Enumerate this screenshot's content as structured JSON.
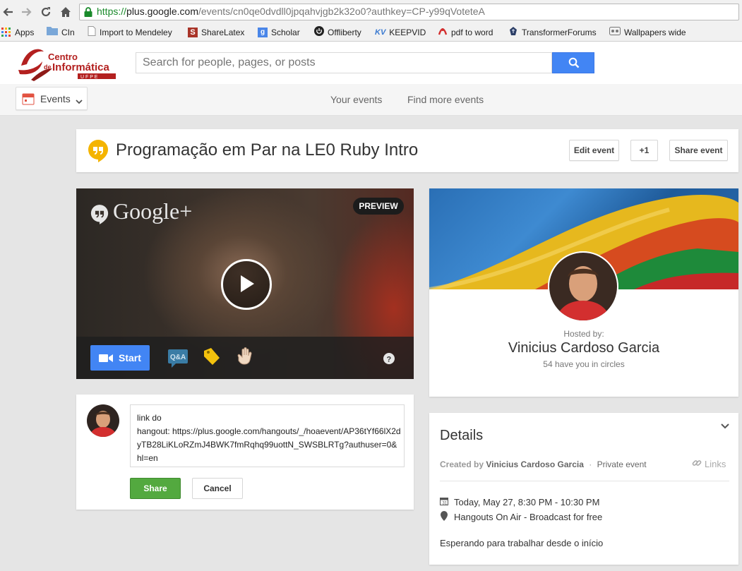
{
  "browser": {
    "url_https": "https://",
    "url_host": "plus.google.com",
    "url_path": "/events/cn0qe0dvdll0jpqahvjgb2k32o0?authkey=CP-y99qVoteteA",
    "bookmarks": [
      {
        "label": "Apps",
        "icon": "apps-grid-icon",
        "color": "#e94235"
      },
      {
        "label": "CIn",
        "icon": "folder-icon",
        "color": "#7aa7d8"
      },
      {
        "label": "Import to Mendeley",
        "icon": "page-icon",
        "color": "#ffffff"
      },
      {
        "label": "ShareLatex",
        "icon": "sharelatex-icon",
        "color": "#a93529"
      },
      {
        "label": "Scholar",
        "icon": "scholar-icon",
        "color": "#4a86e8"
      },
      {
        "label": "Offliberty",
        "icon": "power-icon",
        "color": "#222222"
      },
      {
        "label": "KEEPVID",
        "icon": "kv-icon",
        "color": "#3c7bd1",
        "badge": "KV"
      },
      {
        "label": "pdf to word",
        "icon": "pdf-icon",
        "color": "#d32f2f"
      },
      {
        "label": "TransformerForums",
        "icon": "transformer-icon",
        "color": "#333333"
      },
      {
        "label": "Wallpapers wide",
        "icon": "wallpapers-icon",
        "color": "#777777"
      }
    ]
  },
  "header": {
    "logo_line1": "Centro",
    "logo_line2_prefix": "de",
    "logo_line2": "Informática",
    "logo_line3": "U F P E",
    "search_placeholder": "Search for people, pages, or posts"
  },
  "subnav": {
    "events_label": "Events",
    "links": [
      "Your events",
      "Find more events"
    ]
  },
  "event": {
    "title": "Programação em Par na LE0 Ruby Intro",
    "buttons": {
      "edit": "Edit event",
      "plus_one": "+1",
      "share": "Share event"
    }
  },
  "hangout": {
    "brand": "Google+",
    "preview_badge": "PREVIEW",
    "start_label": "Start",
    "qa_label": "Q&A"
  },
  "host": {
    "hosted_by_label": "Hosted by:",
    "name": "Vinicius Cardoso Garcia",
    "circles": "54 have you in circles"
  },
  "comment": {
    "text": "link do\nhangout: https://plus.google.com/hangouts/_/hoaevent/AP36tYf66lX2dyTB28LiKLoRZmJ4BWK7fmRqhq99uottN_SWSBLRTg?authuser=0&hl=en",
    "share_label": "Share",
    "cancel_label": "Cancel"
  },
  "details": {
    "heading": "Details",
    "created_by_label": "Created by",
    "created_by_name": "Vinicius Cardoso Garcia",
    "separator": "·",
    "privacy": "Private event",
    "links_label": "Links",
    "datetime": "Today, May 27, 8:30 PM - 10:30 PM",
    "location": "Hangouts On Air - Broadcast for free",
    "description": "Esperando para trabalhar desde o início"
  },
  "colors": {
    "accent_blue": "#4285f4",
    "share_green": "#53a93f",
    "hangouts_yellow": "#f4b400"
  }
}
